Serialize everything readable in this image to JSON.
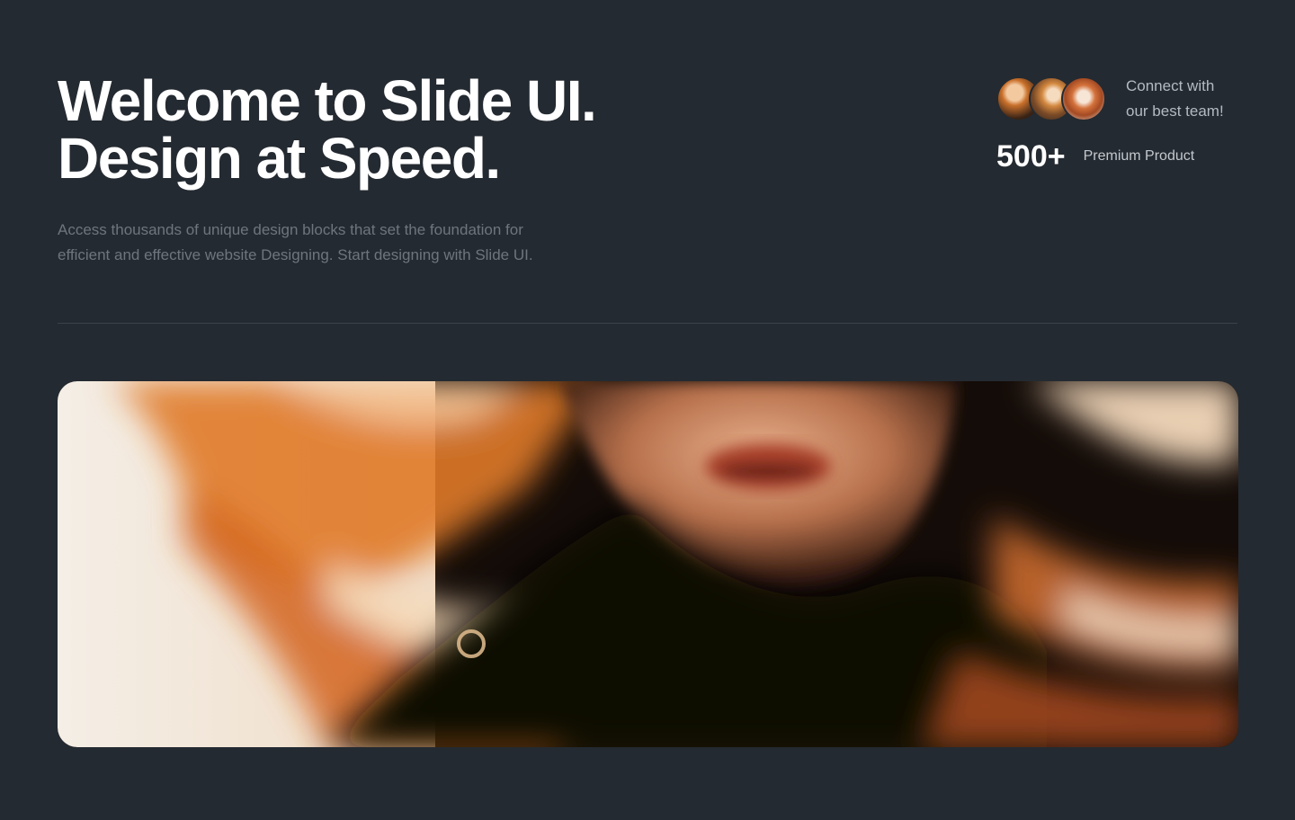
{
  "hero": {
    "title_line1": "Welcome to Slide UI.",
    "title_line2": "Design at Speed.",
    "description_line1": "Access thousands of unique design blocks that set the foundation for",
    "description_line2": "efficient and effective website Designing. Start designing with Slide UI."
  },
  "team": {
    "text_line1": "Connect with",
    "text_line2": "our best team!"
  },
  "stats": {
    "number": "500+",
    "label": "Premium Product"
  },
  "colors": {
    "background": "#242a31",
    "title": "#ffffff",
    "description": "#6e757d",
    "accent_hair": "#d06a23"
  }
}
